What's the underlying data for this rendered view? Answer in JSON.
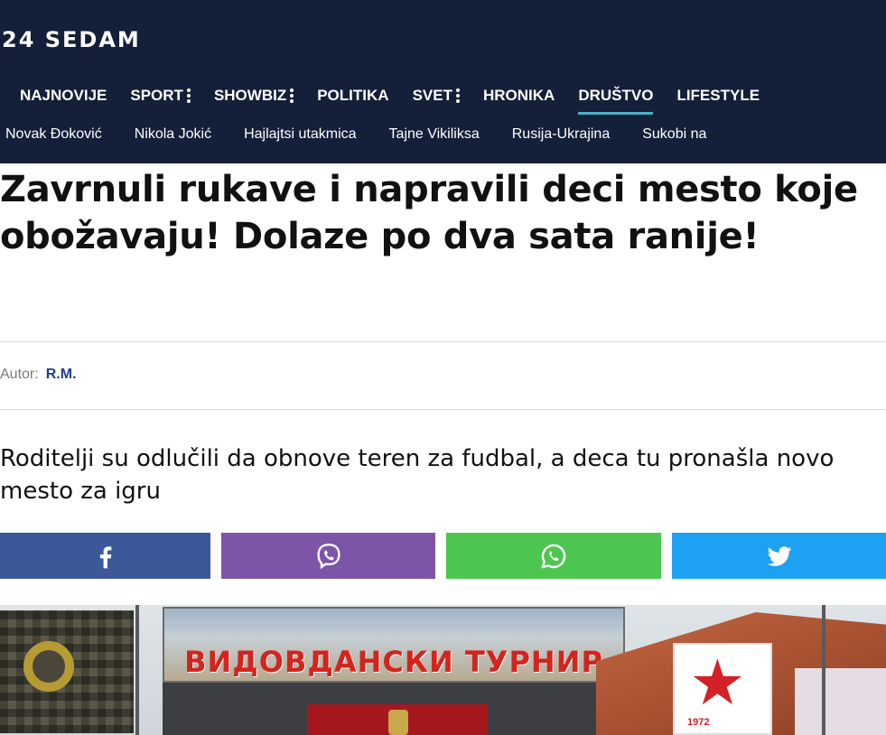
{
  "site": {
    "logo": "24 SEDAM"
  },
  "nav": {
    "items": [
      {
        "label": "NAJNOVIJE",
        "dots": false,
        "active": false
      },
      {
        "label": "SPORT",
        "dots": true,
        "active": false
      },
      {
        "label": "SHOWBIZ",
        "dots": true,
        "active": false
      },
      {
        "label": "POLITIKA",
        "dots": false,
        "active": false
      },
      {
        "label": "SVET",
        "dots": true,
        "active": false
      },
      {
        "label": "HRONIKA",
        "dots": false,
        "active": false
      },
      {
        "label": "DRUŠTVO",
        "dots": false,
        "active": true
      },
      {
        "label": "LIFESTYLE",
        "dots": false,
        "active": false
      }
    ]
  },
  "topics": [
    "Novak Đoković",
    "Nikola Jokić",
    "Hajlajtsi utakmica",
    "Tajne Vikiliksa",
    "Rusija-Ukrajina",
    "Sukobi na"
  ],
  "article": {
    "title": "Zavrnuli rukave i napravili deci mesto koje obožavaju! Dolaze po dva sata ranije!",
    "author_label": "Autor:",
    "author_name": "R.M.",
    "lead": "Roditelji su odlučili da obnove teren za fudbal, a deca tu pronašla novo mesto za igru"
  },
  "share": [
    {
      "network": "facebook",
      "icon": "facebook-icon",
      "color": "#3b5998"
    },
    {
      "network": "viber",
      "icon": "viber-icon",
      "color": "#7d55a8"
    },
    {
      "network": "whatsapp",
      "icon": "whatsapp-icon",
      "color": "#4cc64f"
    },
    {
      "network": "twitter",
      "icon": "twitter-icon",
      "color": "#1da1f2"
    }
  ],
  "photo": {
    "banner_text": "ВИДОВДАНСКИ ТУРНИР",
    "badge_year": "1972"
  },
  "colors": {
    "header_bg": "#142039",
    "active_underline": "#4ab0c5",
    "author_link": "#1f3d8f"
  }
}
